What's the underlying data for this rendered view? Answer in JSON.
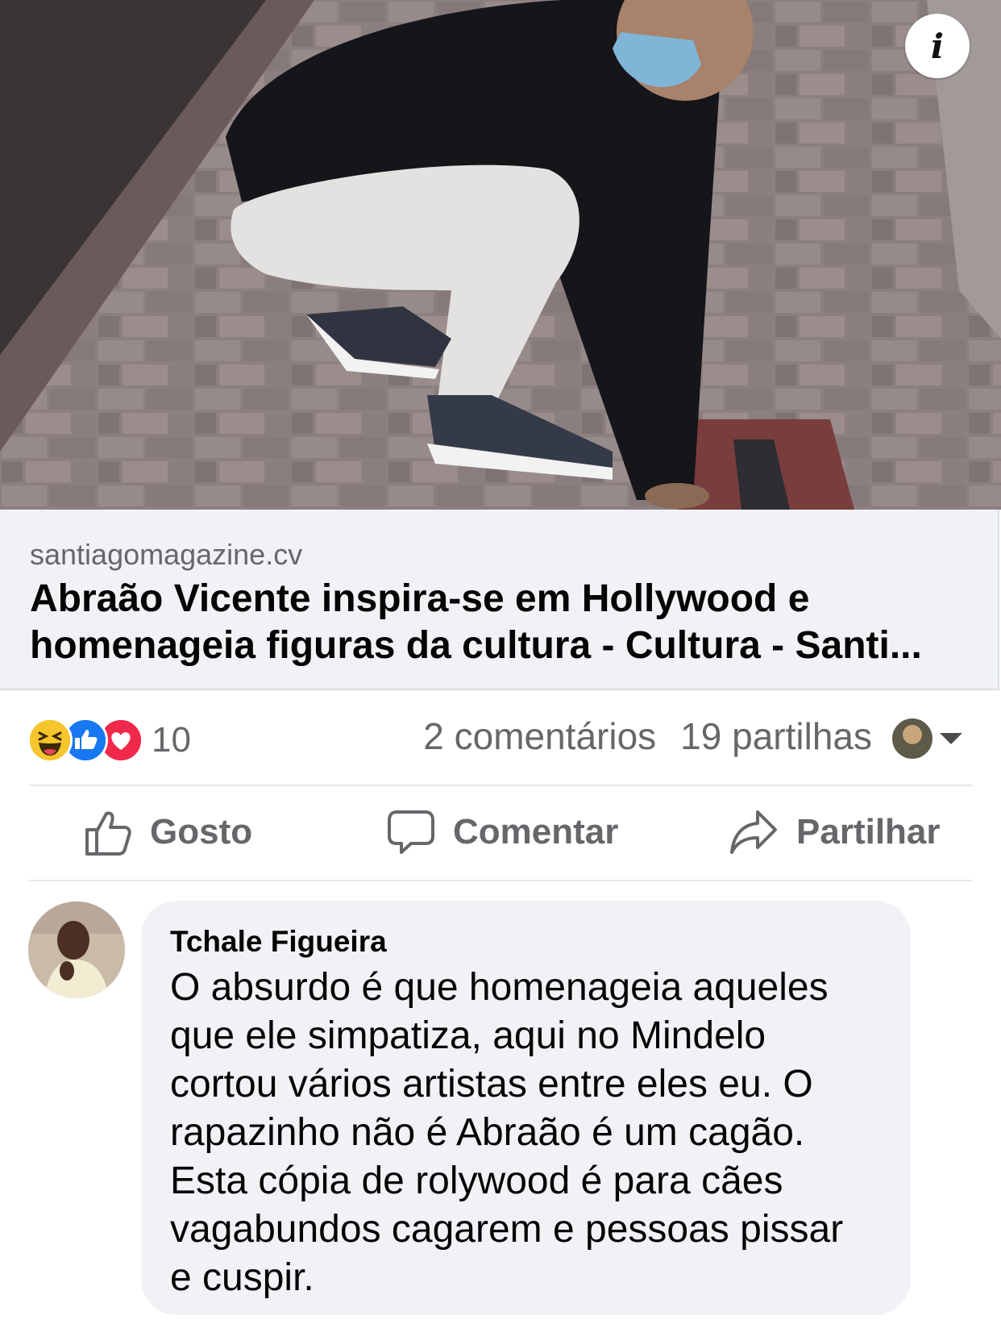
{
  "link_preview": {
    "image_alt": "Man crouching on brick sidewalk next to a plaque",
    "domain": "santiagomagazine.cv",
    "title_lines": [
      "Abraão Vicente inspira-se em Hollywood e",
      "homenageia figuras da cultura - Cultura - Santi..."
    ],
    "info_icon": "i"
  },
  "reactions": {
    "icons": [
      "haha-icon",
      "like-icon",
      "love-icon"
    ],
    "count": "10",
    "comments": "2 comentários",
    "shares": "19 partilhas"
  },
  "actions": {
    "like_label": "Gosto",
    "comment_label": "Comentar",
    "share_label": "Partilhar"
  },
  "comment": {
    "author": "Tchale Figueira",
    "lines": [
      "O absurdo é que homenageia aqueles",
      "que ele simpatiza, aqui no Mindelo",
      "cortou vários artistas entre eles eu. O",
      "rapazinho não é Abraão é um cagão.",
      "Esta cópia de rolywood é para cães",
      "vagabundos cagarem e pessoas pissar",
      "e cuspir."
    ]
  },
  "colors": {
    "secondary_text": "#65676b",
    "bubble_bg": "#f0f2f5",
    "like_blue": "#1877f2",
    "love_red": "#f0284a",
    "haha_yellow": "#f7c52c"
  }
}
